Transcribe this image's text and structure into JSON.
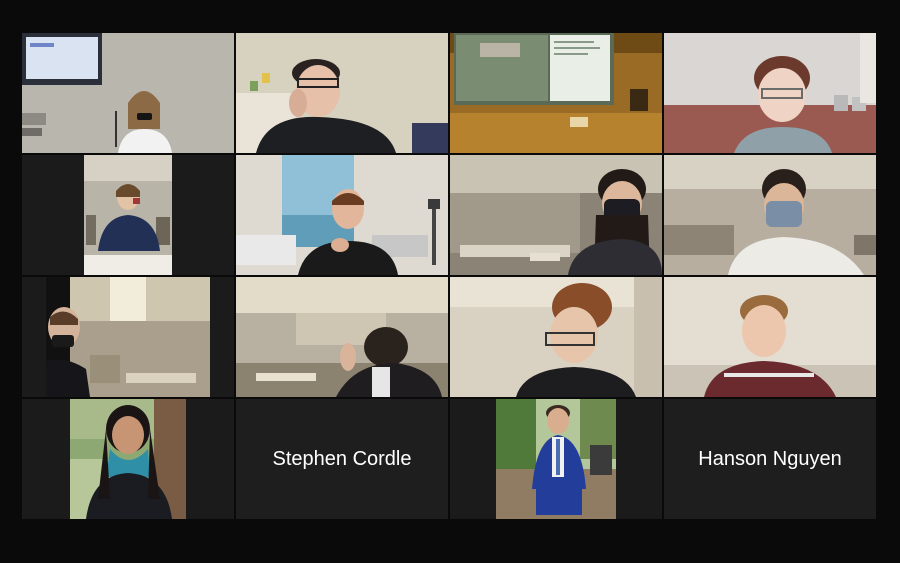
{
  "app": {
    "window_title": ""
  },
  "participants": [
    {
      "id": "p1",
      "active": true
    },
    {
      "id": "p2"
    },
    {
      "id": "p3"
    },
    {
      "id": "p4"
    },
    {
      "id": "p5"
    },
    {
      "id": "p6"
    },
    {
      "id": "p7"
    },
    {
      "id": "p8"
    },
    {
      "id": "p9"
    },
    {
      "id": "p10"
    },
    {
      "id": "p11"
    },
    {
      "id": "p12"
    },
    {
      "id": "p13"
    },
    {
      "id": "p14",
      "display_name": "Stephen Cordle"
    },
    {
      "id": "p15"
    },
    {
      "id": "p16",
      "display_name": "Hanson Nguyen"
    }
  ],
  "colors": {
    "background": "#0a0a0a",
    "tile_background": "#1e1e1e",
    "active_speaker_border": "#b3d86b",
    "name_text": "#ffffff"
  }
}
